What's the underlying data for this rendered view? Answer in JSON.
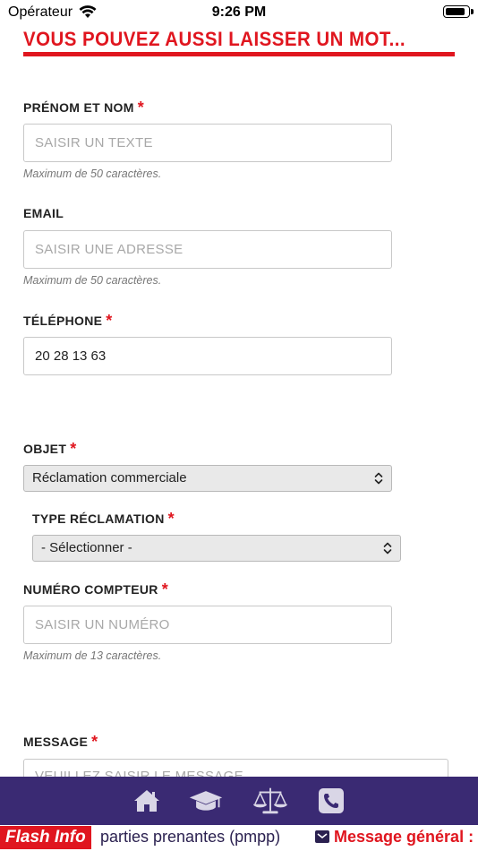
{
  "status_bar": {
    "carrier": "Opérateur",
    "time": "9:26 PM",
    "battery_level": 0.9
  },
  "form": {
    "title": "VOUS POUVEZ AUSSI LAISSER UN MOT...",
    "required_mark": "*",
    "name": {
      "label": "PRÉNOM ET NOM",
      "placeholder": "SAISIR UN TEXTE",
      "value": "",
      "hint": "Maximum de 50 caractères."
    },
    "email": {
      "label": "EMAIL",
      "placeholder": "SAISIR UNE ADRESSE",
      "value": "",
      "hint": "Maximum de 50 caractères."
    },
    "phone": {
      "label": "TÉLÉPHONE",
      "placeholder": "",
      "value": "20 28 13 63"
    },
    "subject": {
      "label": "OBJET",
      "selected": "Réclamation commerciale"
    },
    "claim_type": {
      "label": "TYPE RÉCLAMATION",
      "selected": "- Sélectionner -"
    },
    "meter_number": {
      "label": "NUMÉRO COMPTEUR",
      "placeholder": "SAISIR UN NUMÉRO",
      "value": "",
      "hint": "Maximum de 13 caractères."
    },
    "message": {
      "label": "MESSAGE",
      "placeholder": "VEUILLEZ SAISIR LE MESSAGE",
      "value": ""
    }
  },
  "bottom_nav": {
    "items": [
      {
        "icon": "home-icon"
      },
      {
        "icon": "graduation-cap-icon"
      },
      {
        "icon": "balance-scale-icon"
      },
      {
        "icon": "phone-icon"
      }
    ]
  },
  "ticker": {
    "label": "Flash Info",
    "text": "parties prenantes (pmpp)",
    "message_label": "Message général :"
  },
  "colors": {
    "accent": "#e0161f",
    "nav_background": "#3a2a73",
    "nav_icon": "#d9d6e6"
  }
}
